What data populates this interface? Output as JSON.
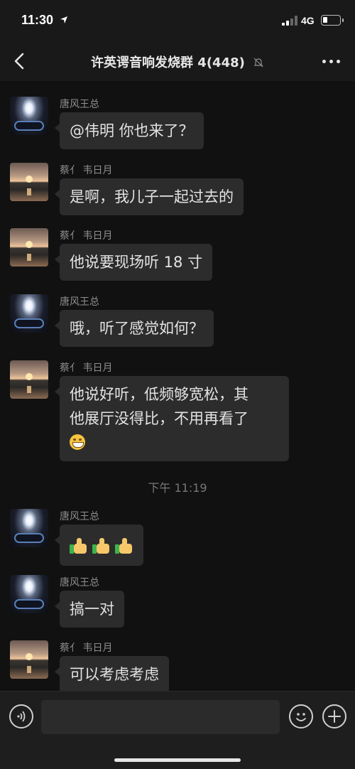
{
  "status": {
    "time": "11:30",
    "network": "4G"
  },
  "nav": {
    "title": "许英谔音响发烧群 4(448)"
  },
  "icons": {
    "back": "chevron-left-icon",
    "mute": "bell-off-icon",
    "more": "more-dots-icon",
    "voice": "voice-icon",
    "emoji": "emoji-icon",
    "plus": "plus-icon"
  },
  "messages": [
    {
      "sender": "唐风王总",
      "avatar": "car",
      "text": "@伟明 你也来了？"
    },
    {
      "sender": "蔡亻 韦日月",
      "avatar": "sunset",
      "text": "是啊，我儿子一起过去的"
    },
    {
      "sender": "蔡亻 韦日月",
      "avatar": "sunset",
      "text": "他说要现场听 18 寸"
    },
    {
      "sender": "唐风王总",
      "avatar": "car",
      "text": "哦，听了感觉如何？"
    },
    {
      "sender": "蔡亻 韦日月",
      "avatar": "sunset",
      "line1": "他说好听，低频够宽松，其",
      "line2": "他展厅没得比，不用再看了",
      "emoji": "grinning-face-emoji"
    },
    {
      "sender": "唐风王总",
      "avatar": "car",
      "emoji": "thumbs-up-emoji",
      "count": 3
    },
    {
      "sender": "唐风王总",
      "avatar": "car",
      "text": "搞一对"
    },
    {
      "sender": "蔡亻 韦日月",
      "avatar": "sunset",
      "text": "可以考虑考虑"
    }
  ],
  "divider": {
    "time": "下午 11:19"
  },
  "input": {
    "value": "",
    "placeholder": ""
  }
}
